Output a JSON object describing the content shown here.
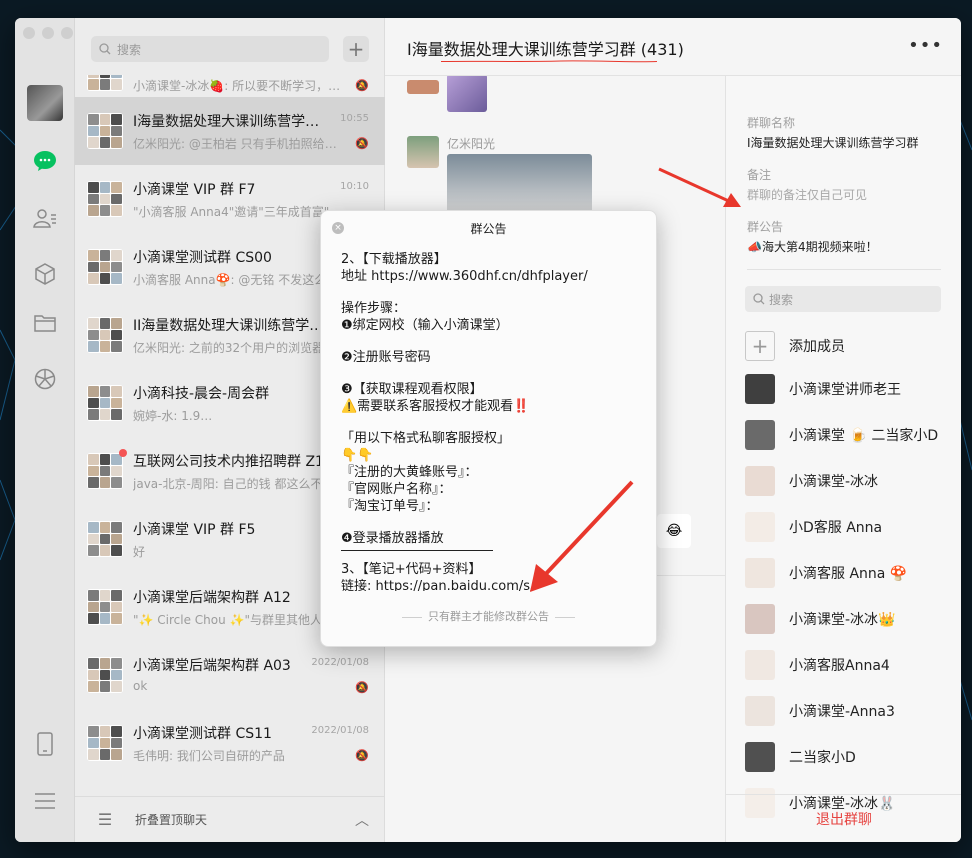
{
  "search": {
    "placeholder": "搜索",
    "plus": "+"
  },
  "chats": [
    {
      "name": "",
      "time": "",
      "msg": "小滴课堂-冰冰🍓: 所以要不断学习，…",
      "muted": true,
      "partial": true
    },
    {
      "name": "I海量数据处理大课训练营学…",
      "time": "10:55",
      "msg": "亿米阳光: @王柏岩 只有手机拍照给你…",
      "muted": true,
      "active": true
    },
    {
      "name": "小滴课堂 VIP 群 F7",
      "time": "10:10",
      "msg": "\"小滴客服 Anna4\"邀请\"三年成首富\"…",
      "muted": false
    },
    {
      "name": "小滴课堂测试群 CS00",
      "time": "",
      "msg": "小滴客服 Anna🍄: @无铭 不发这么…",
      "muted": false
    },
    {
      "name": "II海量数据处理大课训练营学…",
      "time": "",
      "msg": "亿米阳光: 之前的32个用户的浏览器…",
      "muted": false
    },
    {
      "name": "小滴科技-晨会-周会群",
      "time": "",
      "msg": "婉婷-水: 1.9…",
      "muted": false
    },
    {
      "name": "互联网公司技术内推招聘群 Z1",
      "time": "",
      "msg": "java-北京-周阳: 自己的钱 都这么不…",
      "muted": false,
      "dot": true
    },
    {
      "name": "小滴课堂 VIP 群 F5",
      "time": "",
      "msg": "好",
      "muted": false
    },
    {
      "name": "小滴课堂后端架构群 A12",
      "time": "",
      "msg": "\"✨ Circle Chou ✨\"与群里其他人都…",
      "muted": false
    },
    {
      "name": "小滴课堂后端架构群 A03",
      "time": "2022/01/08",
      "msg": "ok",
      "muted": true
    },
    {
      "name": "小滴课堂测试群 CS11",
      "time": "2022/01/08",
      "msg": "毛伟明: 我们公司自研的产品",
      "muted": true
    }
  ],
  "fold_label": "折叠置顶聊天",
  "chat": {
    "title": "I海量数据处理大课训练营学习群 (431)",
    "more": "•••",
    "sender": "亿米阳光",
    "emoji_tail": "😂"
  },
  "info": {
    "group_name_label": "群聊名称",
    "group_name": "I海量数据处理大课训练营学习群",
    "remark_label": "备注",
    "remark_value": "群聊的备注仅自己可见",
    "notice_label": "群公告",
    "notice_value": "📣海大第4期视频来啦！",
    "member_search_placeholder": "搜索",
    "add_member": "添加成员",
    "members": [
      "小滴课堂讲师老王",
      "小滴课堂 🍺 二当家小D",
      "小滴课堂-冰冰",
      "小D客服 Anna",
      "小滴客服 Anna 🍄",
      "小滴课堂-冰冰👑",
      "小滴客服Anna4",
      "小滴课堂-Anna3",
      "二当家小D",
      "小滴课堂-冰冰🐰"
    ],
    "quit": "退出群聊"
  },
  "popup": {
    "title": "群公告",
    "close": "×",
    "lines": [
      "2、【下载播放器】",
      "地址 https://www.360dhf.cn/dhfplayer/",
      "",
      "操作步骤：",
      "❶绑定网校（输入小滴课堂）",
      "",
      "❷注册账号密码",
      "",
      "❸【获取课程观看权限】",
      "⚠️需要联系客服授权才能观看‼️",
      "",
      "「用以下格式私聊客服授权」",
      "👇👇",
      "『注册的大黄蜂账号』：",
      "『官网账户名称』：",
      "『淘宝订单号』：",
      "",
      "❹登录播放器播放",
      "---",
      "3、【笔记+代码+资料】",
      "链接: https://pan.baidu.com/s/"
    ],
    "footer": "只有群主才能修改群公告"
  },
  "colors": {
    "accent_green": "#07c160",
    "quit_red": "#e64340",
    "arrow_red": "#e8372c"
  }
}
